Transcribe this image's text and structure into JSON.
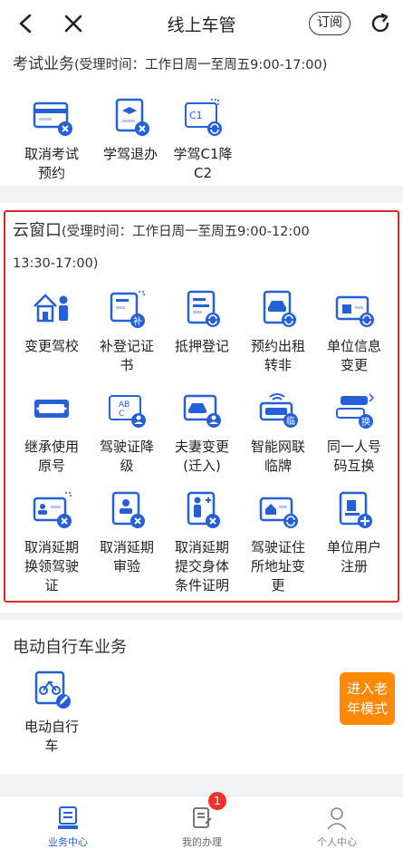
{
  "header": {
    "title": "线上车管",
    "subscribe_label": "订阅"
  },
  "exam": {
    "title": "考试业务",
    "note": "(受理时间：工作日周一至周五9:00-17:00)",
    "items": [
      {
        "label": "取消考试预约",
        "icon": "id-card-cancel-icon"
      },
      {
        "label": "学驾退办",
        "icon": "document-cancel-icon"
      },
      {
        "label": "学驾C1降C2",
        "icon": "license-downgrade-icon"
      }
    ]
  },
  "cloud": {
    "title": "云窗口",
    "note_line1": "(受理时间：工作日周一至周五9:00-12:00",
    "note_line2": "13:30-17:00)",
    "items": [
      {
        "label": "变更驾校",
        "icon": "school-person-icon"
      },
      {
        "label": "补登记证书",
        "icon": "certificate-reissue-icon"
      },
      {
        "label": "抵押登记",
        "icon": "mortgage-document-icon"
      },
      {
        "label": "预约出租转非",
        "icon": "taxi-convert-icon"
      },
      {
        "label": "单位信息变更",
        "icon": "company-info-icon"
      },
      {
        "label": "继承使用原号",
        "icon": "license-plate-icon"
      },
      {
        "label": "驾驶证降级",
        "icon": "license-abc-downgrade-icon"
      },
      {
        "label": "夫妻变更(迁入)",
        "icon": "couple-transfer-icon"
      },
      {
        "label": "智能网联临牌",
        "icon": "smart-plate-icon",
        "badge": "临"
      },
      {
        "label": "同一人号码互换",
        "icon": "plate-swap-icon",
        "badge": "换"
      },
      {
        "label": "取消延期换领驾驶证",
        "icon": "license-renew-cancel-icon"
      },
      {
        "label": "取消延期审验",
        "icon": "inspection-cancel-icon"
      },
      {
        "label": "取消延期提交身体条件证明",
        "icon": "health-proof-cancel-icon"
      },
      {
        "label": "驾驶证住所地址变更",
        "icon": "address-change-icon"
      },
      {
        "label": "单位用户注册",
        "icon": "company-register-icon"
      }
    ]
  },
  "ebike": {
    "title": "电动自行车业务",
    "items": [
      {
        "label": "电动自行车",
        "icon": "ebike-edit-icon"
      }
    ],
    "elder_mode": "进入老年模式"
  },
  "tabbar": {
    "tabs": [
      {
        "label": "业务中心",
        "active": true,
        "icon": "business-center-icon"
      },
      {
        "label": "我的办理",
        "badge": "1",
        "icon": "my-tasks-icon"
      },
      {
        "label": "个人中心",
        "icon": "person-icon"
      }
    ]
  },
  "colors": {
    "accent": "#2560d8",
    "highlight": "#e0262a",
    "orange": "#ff8a00"
  }
}
